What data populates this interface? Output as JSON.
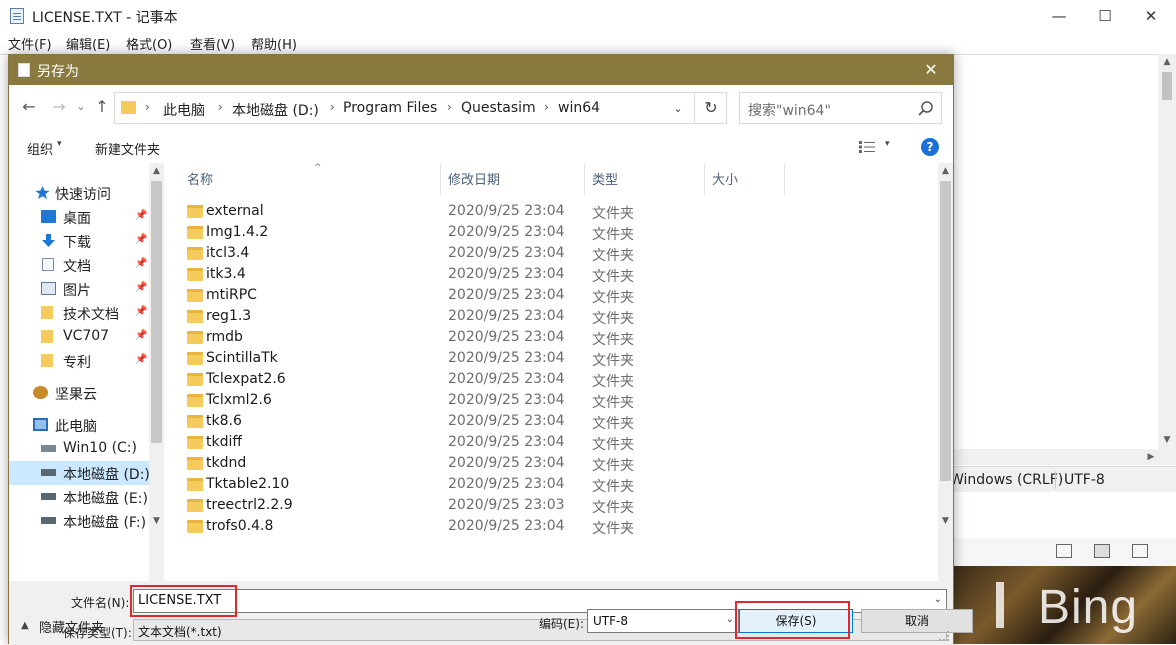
{
  "notepad": {
    "title": "LICENSE.TXT - 记事本",
    "menu": [
      "文件(F)",
      "编辑(E)",
      "格式(O)",
      "查看(V)",
      "帮助(H)"
    ],
    "controls": {
      "minimize": "—",
      "maximize": "☐",
      "close": "✕"
    },
    "status": {
      "eol": "Windows (CRLF)",
      "encoding": "UTF-8"
    },
    "wallpaper_brand": "Bing"
  },
  "dialog": {
    "title": "另存为",
    "close": "✕",
    "nav": {
      "back": "←",
      "forward": "→",
      "recent": "⌄",
      "up": "↑"
    },
    "address": {
      "crumbs": [
        "此电脑",
        "本地磁盘 (D:)",
        "Program Files",
        "Questasim",
        "win64"
      ],
      "separator": "›",
      "dropdown": "⌄",
      "refresh": "↻"
    },
    "search": {
      "placeholder": "搜索\"win64\""
    },
    "toolbar": {
      "organize": "组织",
      "new_folder": "新建文件夹",
      "caret": "▾",
      "help": "?"
    },
    "sidebar": {
      "items": [
        {
          "label": "快速访问",
          "icon": "star-icon",
          "pinned": false
        },
        {
          "label": "桌面",
          "icon": "desktop-icon",
          "pinned": true
        },
        {
          "label": "下载",
          "icon": "download-icon",
          "pinned": true
        },
        {
          "label": "文档",
          "icon": "document-icon",
          "pinned": true
        },
        {
          "label": "图片",
          "icon": "pictures-icon",
          "pinned": true
        },
        {
          "label": "技术文档",
          "icon": "folder-icon",
          "pinned": true
        },
        {
          "label": "VC707",
          "icon": "folder-icon",
          "pinned": true
        },
        {
          "label": "专利",
          "icon": "folder-icon",
          "pinned": true
        },
        {
          "label": "坚果云",
          "icon": "nutstore-icon",
          "pinned": false
        },
        {
          "label": "此电脑",
          "icon": "computer-icon",
          "pinned": false
        },
        {
          "label": "Win10 (C:)",
          "icon": "drive-icon",
          "pinned": false
        },
        {
          "label": "本地磁盘 (D:)",
          "icon": "drive-icon",
          "pinned": false
        },
        {
          "label": "本地磁盘 (E:)",
          "icon": "drive-icon",
          "pinned": false
        },
        {
          "label": "本地磁盘 (F:)",
          "icon": "drive-icon",
          "pinned": false
        }
      ],
      "pin_glyph": "📌",
      "selected_index": 11
    },
    "columns": {
      "name": "名称",
      "date": "修改日期",
      "type": "类型",
      "size": "大小"
    },
    "files": [
      {
        "name": "external",
        "date": "2020/9/25 23:04",
        "type": "文件夹"
      },
      {
        "name": "Img1.4.2",
        "date": "2020/9/25 23:04",
        "type": "文件夹"
      },
      {
        "name": "itcl3.4",
        "date": "2020/9/25 23:04",
        "type": "文件夹"
      },
      {
        "name": "itk3.4",
        "date": "2020/9/25 23:04",
        "type": "文件夹"
      },
      {
        "name": "mtiRPC",
        "date": "2020/9/25 23:04",
        "type": "文件夹"
      },
      {
        "name": "reg1.3",
        "date": "2020/9/25 23:04",
        "type": "文件夹"
      },
      {
        "name": "rmdb",
        "date": "2020/9/25 23:04",
        "type": "文件夹"
      },
      {
        "name": "ScintillaTk",
        "date": "2020/9/25 23:04",
        "type": "文件夹"
      },
      {
        "name": "Tclexpat2.6",
        "date": "2020/9/25 23:04",
        "type": "文件夹"
      },
      {
        "name": "Tclxml2.6",
        "date": "2020/9/25 23:04",
        "type": "文件夹"
      },
      {
        "name": "tk8.6",
        "date": "2020/9/25 23:04",
        "type": "文件夹"
      },
      {
        "name": "tkdiff",
        "date": "2020/9/25 23:04",
        "type": "文件夹"
      },
      {
        "name": "tkdnd",
        "date": "2020/9/25 23:04",
        "type": "文件夹"
      },
      {
        "name": "Tktable2.10",
        "date": "2020/9/25 23:04",
        "type": "文件夹"
      },
      {
        "name": "treectrl2.2.9",
        "date": "2020/9/25 23:03",
        "type": "文件夹"
      },
      {
        "name": "trofs0.4.8",
        "date": "2020/9/25 23:04",
        "type": "文件夹"
      }
    ],
    "filename": {
      "label": "文件名(N):",
      "value": "LICENSE.TXT"
    },
    "filetype": {
      "label": "保存类型(T):",
      "value": "文本文档(*.txt)"
    },
    "hide_folders": "隐藏文件夹",
    "encoding": {
      "label": "编码(E):",
      "value": "UTF-8"
    },
    "save": "保存(S)",
    "cancel": "取消",
    "highlight_color": "#e0282e",
    "title_bar_color": "#8b7a3f"
  }
}
